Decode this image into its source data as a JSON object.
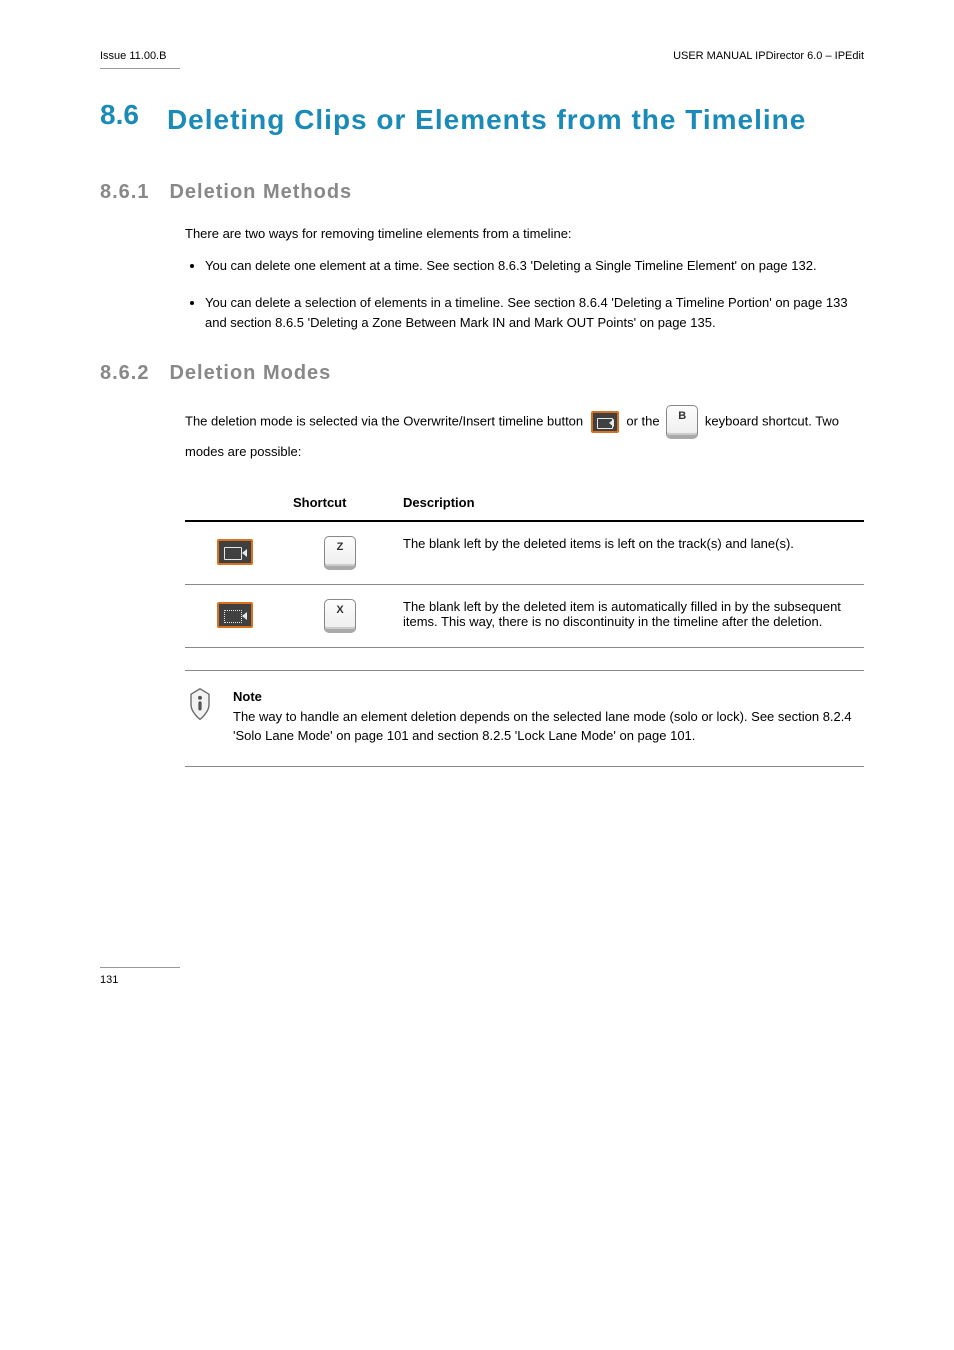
{
  "header": {
    "issue": "Issue 11.00.B",
    "doc": "USER MANUAL IPDirector 6.0 – IPEdit"
  },
  "section": {
    "number": "8.6",
    "title": "Deleting Clips or Elements from the Timeline"
  },
  "sub1": {
    "number": "8.6.1",
    "title": "Deletion Methods",
    "intro": "There are two ways for removing timeline elements from a timeline:",
    "bullets": [
      "You can delete one element at a time. See section 8.6.3 'Deleting a Single Timeline Element' on page 132.",
      "You can delete a selection of elements in a timeline. See section 8.6.4 'Deleting a Timeline Portion' on page 133 and section 8.6.5 'Deleting a Zone Between Mark IN and Mark OUT Points' on page 135."
    ]
  },
  "sub2": {
    "number": "8.6.2",
    "title": "Deletion Modes",
    "para_prefix": "The deletion mode is selected via the Overwrite/Insert timeline button ",
    "para_mid": " or the ",
    "key_b": "B",
    "para_suffix": " keyboard shortcut. Two modes are possible:",
    "table": {
      "headers": [
        "",
        "Shortcut",
        "Description"
      ],
      "rows": [
        {
          "icon": "leave",
          "key": "Z",
          "desc": "The blank left by the deleted items is left on the track(s) and lane(s)."
        },
        {
          "icon": "fill",
          "key": "X",
          "desc": "The blank left by the deleted item is automatically filled in by the subsequent items. This way, there is no discontinuity in the timeline after the deletion."
        }
      ]
    }
  },
  "note": {
    "label": "Note",
    "text": "The way to handle an element deletion depends on the selected lane mode (solo or lock). See section 8.2.4 'Solo Lane Mode' on page 101 and section 8.2.5 'Lock Lane Mode' on page 101."
  },
  "footer": {
    "page": "131"
  }
}
